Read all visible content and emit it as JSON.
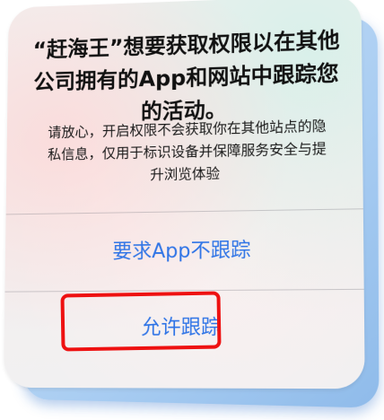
{
  "dialog": {
    "title": "“赶海王”想要获取权限以在其他公司拥有的App和网站中跟踪您的活动。",
    "message": "请放心，开启权限不会获取你在其他站点的隐私信息，仅用于标识设备并保障服务安全与提升浏览体验",
    "actions": [
      {
        "label": "要求App不跟踪"
      },
      {
        "label": "允许跟踪"
      }
    ]
  },
  "colors": {
    "action_text": "#2f74e6",
    "highlight_border": "#ee1111",
    "backdrop": "#a9cdf2"
  }
}
